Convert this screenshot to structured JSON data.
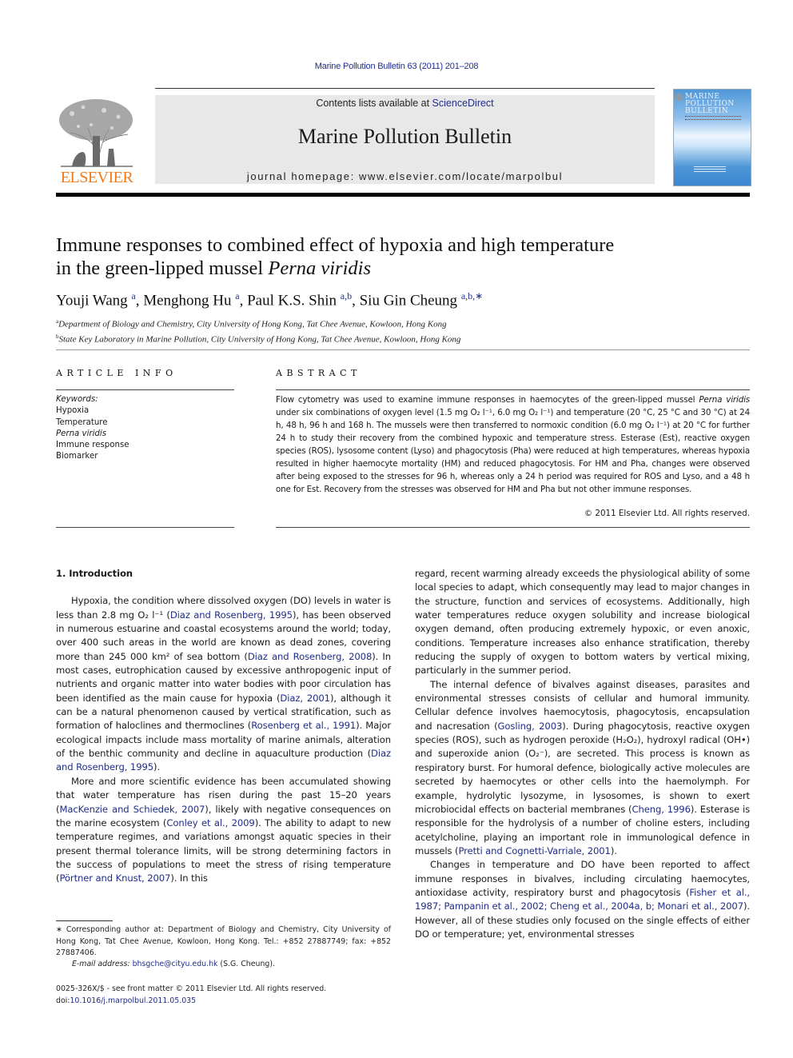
{
  "running_head": "Marine Pollution Bulletin 63 (2011) 201–208",
  "masthead": {
    "contents_prefix": "Contents lists available at ",
    "contents_link": "ScienceDirect",
    "journal_name": "Marine Pollution Bulletin",
    "homepage": "journal homepage: www.elsevier.com/locate/marpolbul",
    "publisher_logo_text": "ELSEVIER",
    "cover_title": [
      "MARINE",
      "POLLUTION",
      "BULLETIN"
    ],
    "logo_color": "#f07a1a",
    "link_color": "#1f2d8a"
  },
  "article": {
    "title_line1": "Immune responses to combined effect of hypoxia and high temperature",
    "title_line2_prefix": "in the green-lipped mussel ",
    "title_line2_italic": "Perna viridis",
    "authors": [
      {
        "name": "Youji Wang",
        "aff": "a"
      },
      {
        "name": "Menghong Hu",
        "aff": "a"
      },
      {
        "name": "Paul K.S. Shin",
        "aff": "a,b"
      },
      {
        "name": "Siu Gin Cheung",
        "aff": "a,b,∗"
      }
    ],
    "affiliations": [
      {
        "mark": "a",
        "text": "Department of Biology and Chemistry, City University of Hong Kong, Tat Chee Avenue, Kowloon, Hong Kong"
      },
      {
        "mark": "b",
        "text": "State Key Laboratory in Marine Pollution, City University of Hong Kong, Tat Chee Avenue, Kowloon, Hong Kong"
      }
    ]
  },
  "article_info": {
    "heading": "ARTICLE INFO",
    "keywords_label": "Keywords:",
    "keywords": [
      "Hypoxia",
      "Temperature",
      "Perna viridis",
      "Immune response",
      "Biomarker"
    ]
  },
  "abstract": {
    "heading": "ABSTRACT",
    "p1": "Flow cytometry was used to examine immune responses in haemocytes of the green-lipped mussel ",
    "p1_italic": "Perna viridis",
    "p2": " under six combinations of oxygen level (1.5 mg O₂ l⁻¹, 6.0 mg O₂ l⁻¹) and temperature (20 °C, 25 °C and 30 °C) at 24 h, 48 h, 96 h and 168 h. The mussels were then transferred to normoxic condition (6.0 mg O₂ l⁻¹) at 20 °C for further 24 h to study their recovery from the combined hypoxic and temperature stress. Esterase (Est), reactive oxygen species (ROS), lysosome content (Lyso) and phagocytosis (Pha) were reduced at high temperatures, whereas hypoxia resulted in higher haemocyte mortality (HM) and reduced phagocytosis. For HM and Pha, changes were observed after being exposed to the stresses for 96 h, whereas only a 24 h period was required for ROS and Lyso, and a 48 h one for Est. Recovery from the stresses was observed for HM and Pha but not other immune responses.",
    "copyright": "© 2011 Elsevier Ltd. All rights reserved."
  },
  "body": {
    "intro_heading": "1. Introduction",
    "left": [
      [
        {
          "t": "Hypoxia, the condition where dissolved oxygen (DO) levels in water is less than 2.8 mg O₂ l⁻¹ ("
        },
        {
          "t": "Diaz and Rosenberg, 1995",
          "link": true
        },
        {
          "t": "), has been observed in numerous estuarine and coastal ecosystems around the world; today, over 400 such areas in the world are known as dead zones, covering more than 245 000 km² of sea bottom ("
        },
        {
          "t": "Diaz and Rosenberg, 2008",
          "link": true
        },
        {
          "t": "). In most cases, eutrophication caused by excessive anthropogenic input of nutrients and organic matter into water bodies with poor circulation has been identified as the main cause for hypoxia ("
        },
        {
          "t": "Diaz, 2001",
          "link": true
        },
        {
          "t": "), although it can be a natural phenomenon caused by vertical stratification, such as formation of haloclines and thermoclines ("
        },
        {
          "t": "Rosenberg et al., 1991",
          "link": true
        },
        {
          "t": "). Major ecological impacts include mass mortality of marine animals, alteration of the benthic community and decline in aquaculture production ("
        },
        {
          "t": "Diaz and Rosenberg, 1995",
          "link": true
        },
        {
          "t": ")."
        }
      ],
      [
        {
          "t": "More and more scientific evidence has been accumulated showing that water temperature has risen during the past 15–20 years ("
        },
        {
          "t": "MacKenzie and Schiedek, 2007",
          "link": true
        },
        {
          "t": "), likely with negative consequences on the marine ecosystem ("
        },
        {
          "t": "Conley et al., 2009",
          "link": true
        },
        {
          "t": "). The ability to adapt to new temperature regimes, and variations amongst aquatic species in their present thermal tolerance limits, will be strong determining factors in the success of populations to meet the stress of rising temperature ("
        },
        {
          "t": "Pörtner and Knust, 2007",
          "link": true
        },
        {
          "t": "). In this"
        }
      ]
    ],
    "right": [
      [
        {
          "t": "regard, recent warming already exceeds the physiological ability of some local species to adapt, which consequently may lead to major changes in the structure, function and services of ecosystems. Additionally, high water temperatures reduce oxygen solubility and increase biological oxygen demand, often producing extremely hypoxic, or even anoxic, conditions. Temperature increases also enhance stratification, thereby reducing the supply of oxygen to bottom waters by vertical mixing, particularly in the summer period."
        }
      ],
      [
        {
          "t": "The internal defence of bivalves against diseases, parasites and environmental stresses consists of cellular and humoral immunity. Cellular defence involves haemocytosis, phagocytosis, encapsulation and nacresation ("
        },
        {
          "t": "Gosling, 2003",
          "link": true
        },
        {
          "t": "). During phagocytosis, reactive oxygen species (ROS), such as hydrogen peroxide (H₂O₂), hydroxyl radical (OH•) and superoxide anion (O₂⁻), are secreted. This process is known as respiratory burst. For humoral defence, biologically active molecules are secreted by haemocytes or other cells into the haemolymph. For example, hydrolytic lysozyme, in lysosomes, is shown to exert microbiocidal effects on bacterial membranes ("
        },
        {
          "t": "Cheng, 1996",
          "link": true
        },
        {
          "t": "). Esterase is responsible for the hydrolysis of a number of choline esters, including acetylcholine, playing an important role in immunological defence in mussels ("
        },
        {
          "t": "Pretti and Cognetti-Varriale, 2001",
          "link": true
        },
        {
          "t": ")."
        }
      ],
      [
        {
          "t": "Changes in temperature and DO have been reported to affect immune responses in bivalves, including circulating haemocytes, antioxidase activity, respiratory burst and phagocytosis ("
        },
        {
          "t": "Fisher et al., 1987; Pampanin et al., 2002; Cheng et al., 2004a, b; Monari et al., 2007",
          "link": true
        },
        {
          "t": "). However, all of these studies only focused on the single effects of either DO or temperature; yet, environmental stresses"
        }
      ]
    ]
  },
  "footnotes": {
    "corresponding": "∗ Corresponding author at: Department of Biology and Chemistry, City University of Hong Kong, Tat Chee Avenue, Kowloon, Hong Kong. Tel.: +852 27887749; fax: +852 27887406.",
    "email_label": "E-mail address: ",
    "email": "bhsgche@cityu.edu.hk",
    "email_suffix": " (S.G. Cheung).",
    "issn": "0025-326X/$ - see front matter © 2011 Elsevier Ltd. All rights reserved.",
    "doi_prefix": "doi:",
    "doi": "10.1016/j.marpolbul.2011.05.035"
  }
}
